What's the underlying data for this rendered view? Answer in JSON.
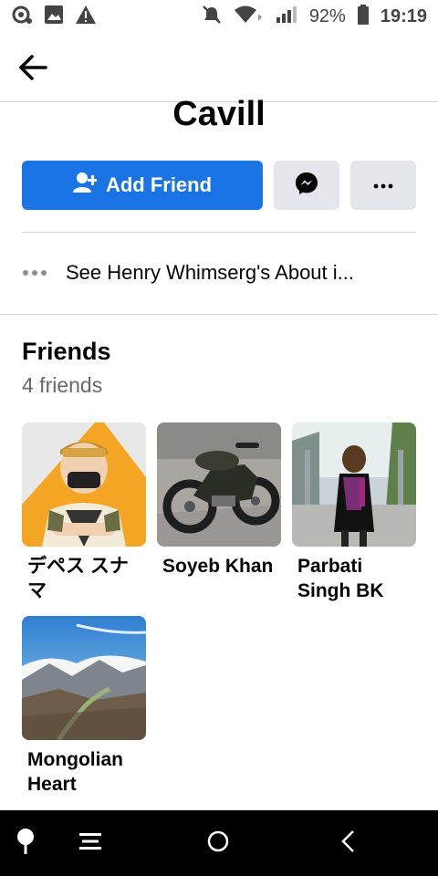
{
  "status_bar": {
    "battery": "92%",
    "time": "19:19",
    "icons": [
      "notification-icon",
      "gallery-icon",
      "warning-icon",
      "mute-icon",
      "wifi-icon",
      "signal-icon",
      "battery-icon"
    ]
  },
  "header": {
    "back_icon": "back-arrow-icon"
  },
  "profile": {
    "name_partial": "Cavill",
    "add_friend_label": "Add Friend",
    "messenger_icon": "messenger-icon",
    "more_icon": "more-icon",
    "about_text": "See Henry Whimserg's About i..."
  },
  "friends": {
    "title": "Friends",
    "count": "4 friends",
    "items": [
      {
        "name": "デペス スナマ",
        "photo": "cartoon-avatar"
      },
      {
        "name": "Soyeb Khan",
        "photo": "motorcycle"
      },
      {
        "name": "Parbati Singh BK",
        "photo": "person-outdoors"
      },
      {
        "name": "Mongolian Heart",
        "photo": "mountain-landscape"
      }
    ]
  },
  "nav": {
    "icons": [
      "pin-icon",
      "menu-icon",
      "home-icon",
      "back-icon"
    ]
  },
  "colors": {
    "accent": "#1b74e4",
    "button_gray": "#e4e6eb",
    "secondary_text": "#65676b"
  }
}
